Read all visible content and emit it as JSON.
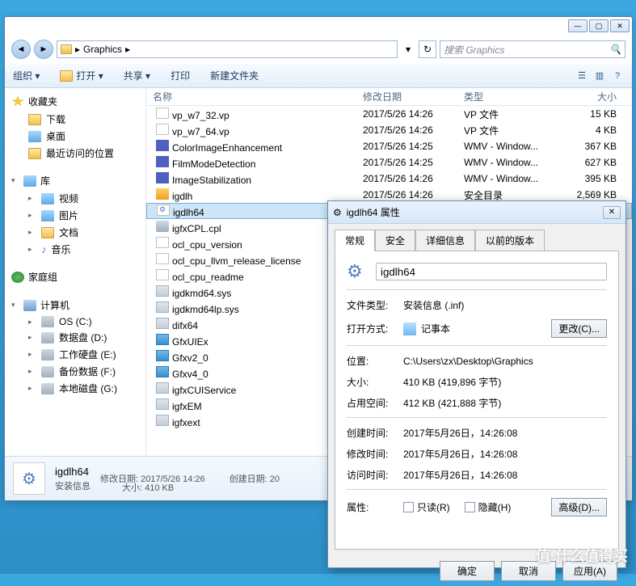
{
  "window": {
    "min": "—",
    "max": "▢",
    "close": "✕"
  },
  "nav": {
    "back": "◄",
    "forward": "►",
    "refresh": "↻"
  },
  "breadcrumb": {
    "segment": "Graphics",
    "arrow": "▸",
    "final": "▸"
  },
  "search": {
    "placeholder": "搜索 Graphics"
  },
  "toolbar": {
    "organize": "组织 ▾",
    "open": "打开  ▾",
    "share": "共享 ▾",
    "print": "打印",
    "new_folder": "新建文件夹",
    "view_icon": "☰",
    "pane_icon": "▥",
    "help_icon": "?"
  },
  "nav_pane": {
    "favorites": "收藏夹",
    "downloads": "下载",
    "desktop": "桌面",
    "recent": "最近访问的位置",
    "libraries": "库",
    "videos": "视频",
    "pictures": "图片",
    "documents": "文档",
    "music": "音乐",
    "homegroup": "家庭组",
    "computer": "计算机",
    "os": "OS (C:)",
    "d1": "数据盘 (D:)",
    "d2": "工作硬盘 (E:)",
    "d3": "备份数据 (F:)",
    "d4": "本地磁盘 (G:)"
  },
  "columns": {
    "name": "名称",
    "date": "修改日期",
    "type": "类型",
    "size": "大小"
  },
  "files": [
    {
      "ico": "fi-file",
      "name": "vp_w7_32.vp",
      "date": "2017/5/26 14:26",
      "type": "VP 文件",
      "size": "15 KB"
    },
    {
      "ico": "fi-file",
      "name": "vp_w7_64.vp",
      "date": "2017/5/26 14:26",
      "type": "VP 文件",
      "size": "4 KB"
    },
    {
      "ico": "fi-wmv",
      "name": "ColorImageEnhancement",
      "date": "2017/5/26 14:25",
      "type": "WMV - Window...",
      "size": "367 KB"
    },
    {
      "ico": "fi-wmv",
      "name": "FilmModeDetection",
      "date": "2017/5/26 14:25",
      "type": "WMV - Window...",
      "size": "627 KB"
    },
    {
      "ico": "fi-wmv",
      "name": "ImageStabilization",
      "date": "2017/5/26 14:26",
      "type": "WMV - Window...",
      "size": "395 KB"
    },
    {
      "ico": "fi-cat",
      "name": "igdlh",
      "date": "2017/5/26 14:26",
      "type": "安全目录",
      "size": "2,569 KB"
    },
    {
      "ico": "fi-inf",
      "name": "igdlh64",
      "date": "",
      "type": "",
      "size": "",
      "selected": true
    },
    {
      "ico": "fi-cpl",
      "name": "igfxCPL.cpl",
      "date": "",
      "type": "",
      "size": ""
    },
    {
      "ico": "fi-file",
      "name": "ocl_cpu_version",
      "date": "",
      "type": "",
      "size": ""
    },
    {
      "ico": "fi-file",
      "name": "ocl_cpu_llvm_release_license",
      "date": "",
      "type": "",
      "size": ""
    },
    {
      "ico": "fi-file",
      "name": "ocl_cpu_readme",
      "date": "",
      "type": "",
      "size": ""
    },
    {
      "ico": "fi-sys",
      "name": "igdkmd64.sys",
      "date": "",
      "type": "",
      "size": ""
    },
    {
      "ico": "fi-sys",
      "name": "igdkmd64lp.sys",
      "date": "",
      "type": "",
      "size": ""
    },
    {
      "ico": "fi-dll",
      "name": "difx64",
      "date": "",
      "type": "",
      "size": ""
    },
    {
      "ico": "fi-app",
      "name": "GfxUIEx",
      "date": "",
      "type": "",
      "size": ""
    },
    {
      "ico": "fi-app",
      "name": "Gfxv2_0",
      "date": "",
      "type": "",
      "size": ""
    },
    {
      "ico": "fi-app",
      "name": "Gfxv4_0",
      "date": "",
      "type": "",
      "size": ""
    },
    {
      "ico": "fi-dll",
      "name": "igfxCUIService",
      "date": "",
      "type": "",
      "size": ""
    },
    {
      "ico": "fi-dll",
      "name": "igfxEM",
      "date": "",
      "type": "",
      "size": ""
    },
    {
      "ico": "fi-dll",
      "name": "igfxext",
      "date": "",
      "type": "",
      "size": ""
    }
  ],
  "details": {
    "name": "igdlh64",
    "sub": "安装信息",
    "mod_label": "修改日期:",
    "mod": "2017/5/26 14:26",
    "size_label": "大小:",
    "size": "410 KB",
    "created_label": "创建日期:",
    "created": "20"
  },
  "props": {
    "title": "igdlh64 属性",
    "tabs": {
      "general": "常规",
      "security": "安全",
      "details": "详细信息",
      "prev": "以前的版本"
    },
    "filename": "igdlh64",
    "type_label": "文件类型:",
    "type": "安装信息 (.inf)",
    "open_label": "打开方式:",
    "open_with": "记事本",
    "change": "更改(C)...",
    "loc_label": "位置:",
    "location": "C:\\Users\\zx\\Desktop\\Graphics",
    "size_label": "大小:",
    "size": "410 KB (419,896 字节)",
    "disk_label": "占用空间:",
    "disk": "412 KB (421,888 字节)",
    "created_label": "创建时间:",
    "created": "2017年5月26日，14:26:08",
    "modified_label": "修改时间:",
    "modified": "2017年5月26日，14:26:08",
    "accessed_label": "访问时间:",
    "accessed": "2017年5月26日，14:26:08",
    "attr_label": "属性:",
    "readonly": "只读(R)",
    "hidden": "隐藏(H)",
    "advanced": "高级(D)...",
    "ok": "确定",
    "cancel": "取消",
    "apply": "应用(A)"
  },
  "watermark": "值·什么值得买"
}
